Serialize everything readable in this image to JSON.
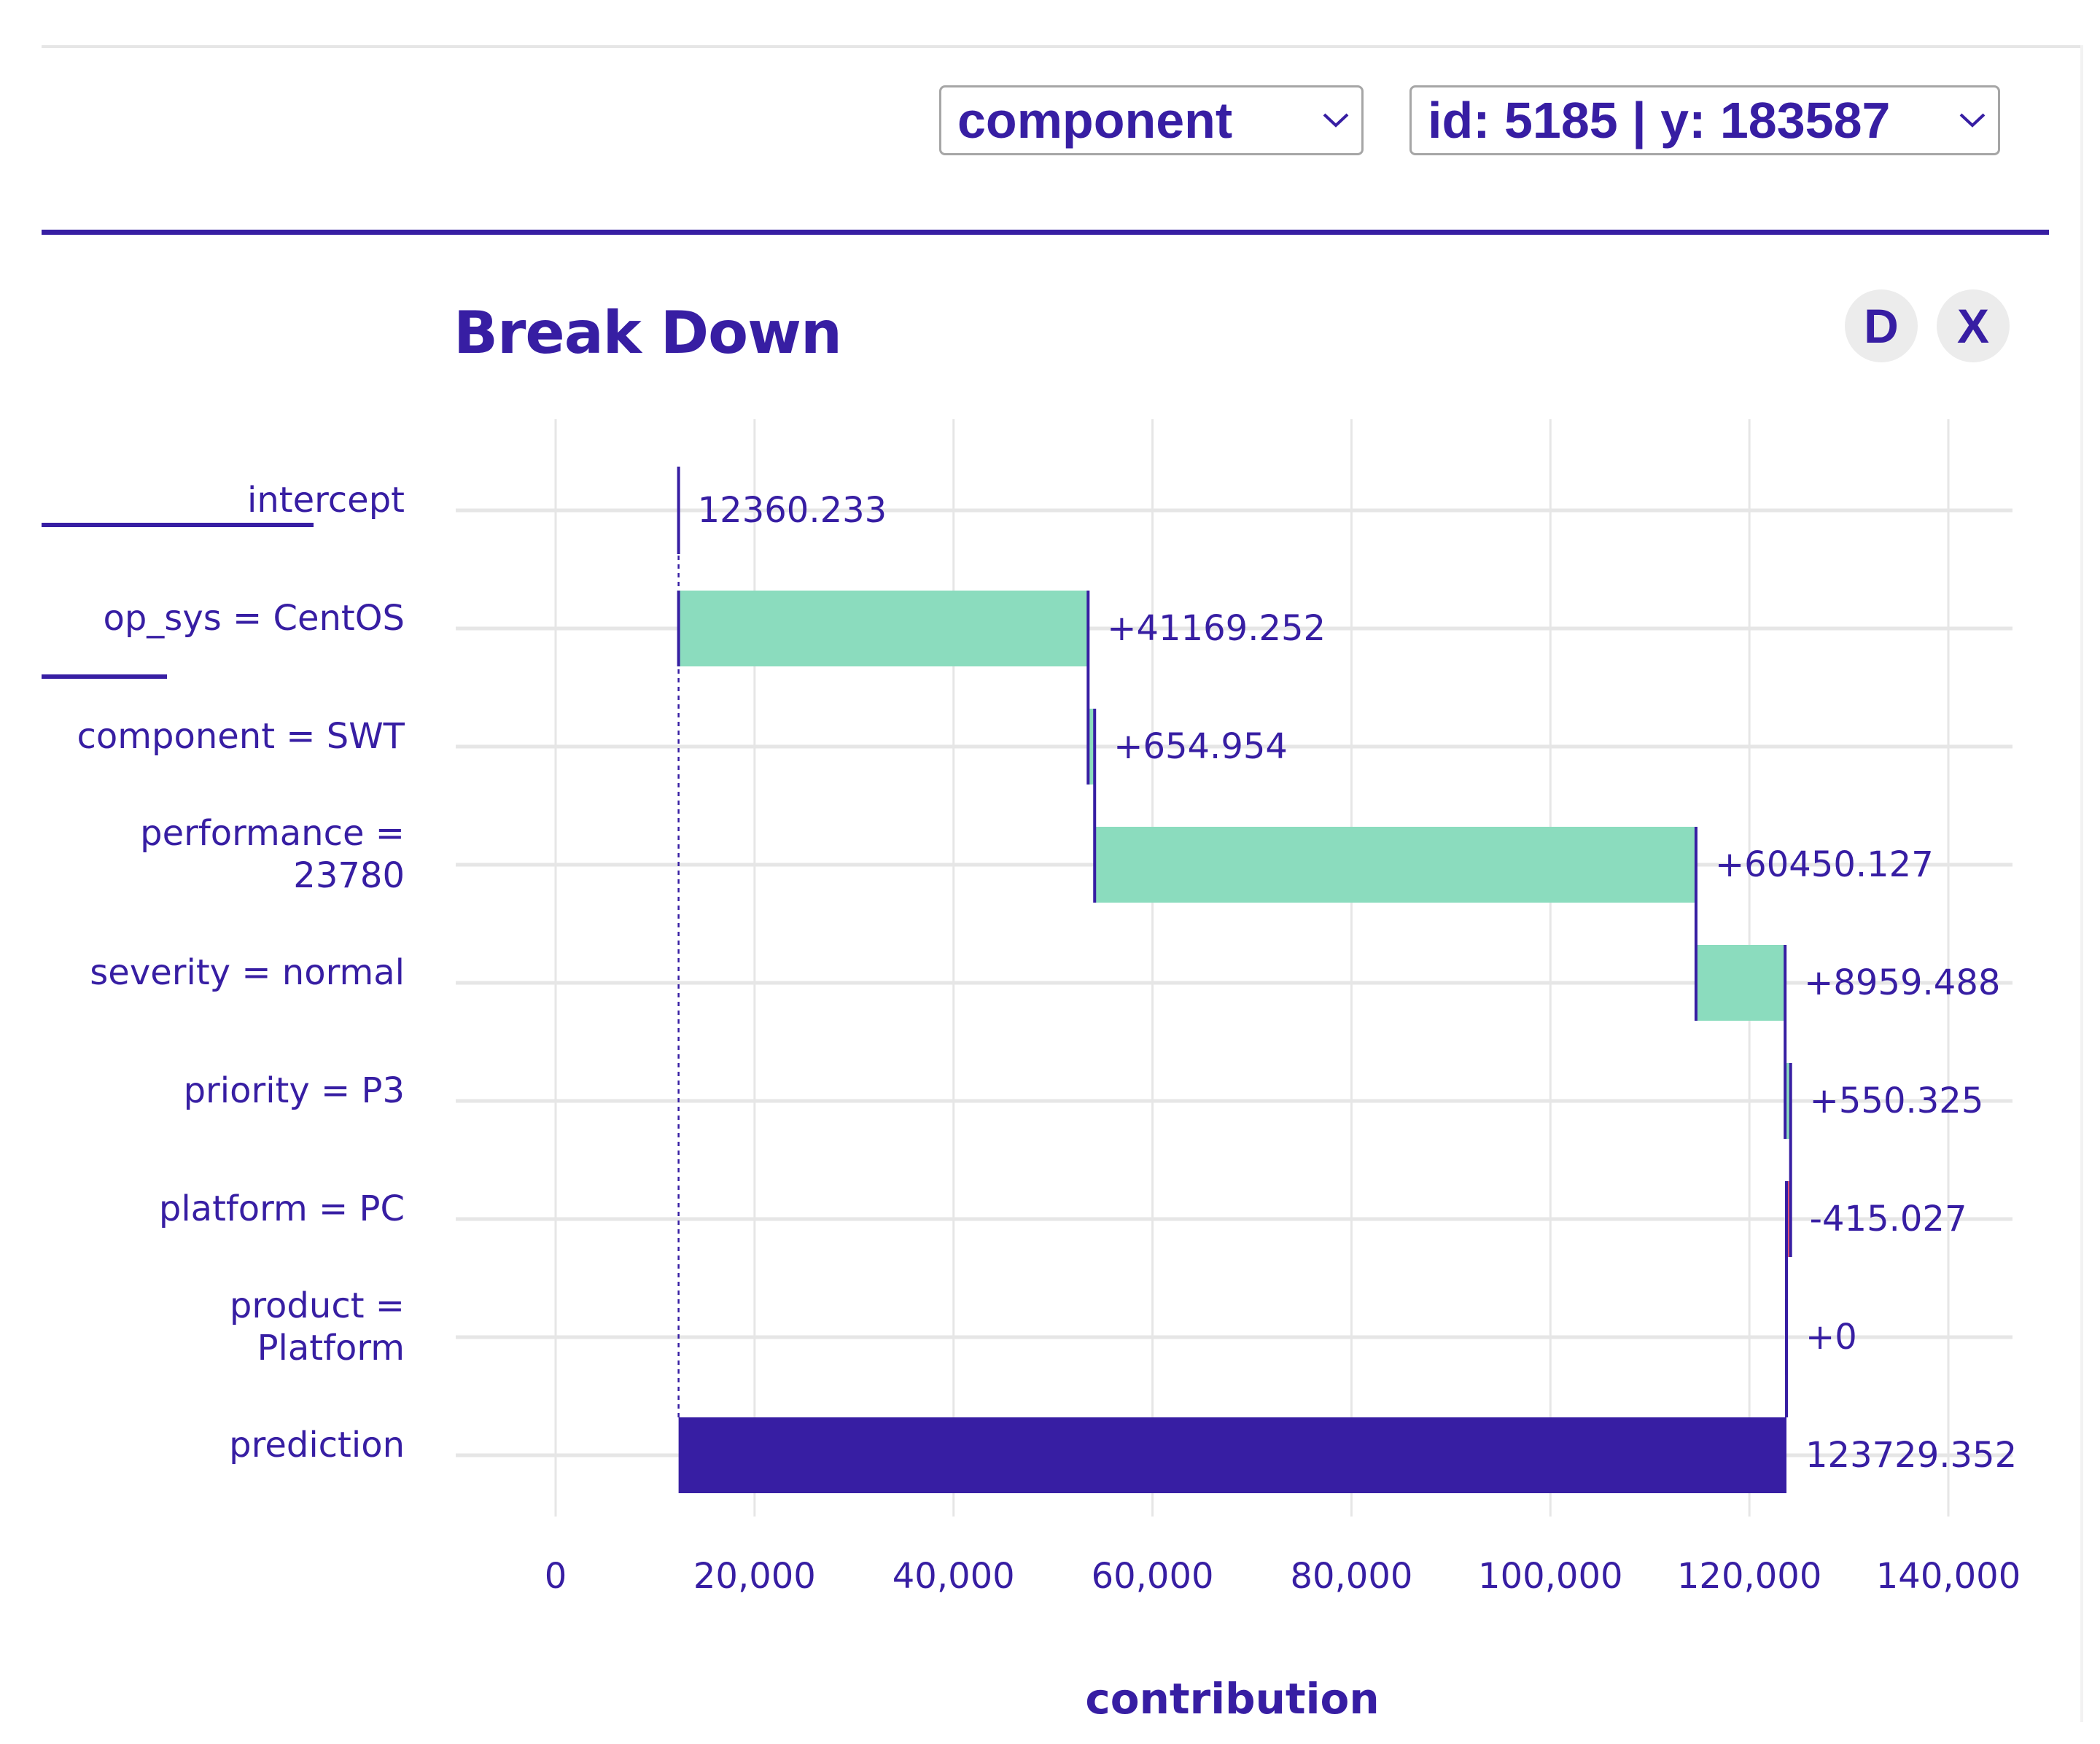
{
  "controls": {
    "variable_select": {
      "value": "component",
      "icon": "chevron-down-icon"
    },
    "observation_select": {
      "value": "id: 5185 | y: 183587",
      "icon": "chevron-down-icon"
    },
    "buttons": {
      "d_label": "D",
      "x_label": "X"
    }
  },
  "colors": {
    "primary": "#371ea3",
    "positive": "#8bdcbe",
    "negative": "#f05a71",
    "grid": "#e6e6e6"
  },
  "chart_data": {
    "type": "bar",
    "subtype": "waterfall",
    "title": "Break Down",
    "xlabel": "contribution",
    "ylabel": "",
    "xlim": [
      0,
      140000
    ],
    "xticks": [
      0,
      20000,
      40000,
      60000,
      80000,
      100000,
      120000,
      140000
    ],
    "xtick_labels": [
      "0",
      "20,000",
      "40,000",
      "60,000",
      "80,000",
      "100,000",
      "120,000",
      "140,000"
    ],
    "grid": true,
    "legend": "none",
    "rows": [
      {
        "label": [
          "intercept"
        ],
        "kind": "intercept",
        "value": 12360.233,
        "value_label": "12360.233"
      },
      {
        "label": [
          "op_sys = CentOS"
        ],
        "kind": "contribution",
        "value": 41169.252,
        "value_label": "+41169.252"
      },
      {
        "label": [
          "component = SWT"
        ],
        "kind": "contribution",
        "value": 654.954,
        "value_label": "+654.954"
      },
      {
        "label": [
          "performance =",
          "23780"
        ],
        "kind": "contribution",
        "value": 60450.127,
        "value_label": "+60450.127"
      },
      {
        "label": [
          "severity = normal"
        ],
        "kind": "contribution",
        "value": 8959.488,
        "value_label": "+8959.488"
      },
      {
        "label": [
          "priority = P3"
        ],
        "kind": "contribution",
        "value": 550.325,
        "value_label": "+550.325"
      },
      {
        "label": [
          "platform = PC"
        ],
        "kind": "contribution",
        "value": -415.027,
        "value_label": "-415.027"
      },
      {
        "label": [
          "product =",
          "Platform"
        ],
        "kind": "contribution",
        "value": 0,
        "value_label": "+0"
      },
      {
        "label": [
          "prediction"
        ],
        "kind": "prediction",
        "value": 123729.352,
        "value_label": "123729.352"
      }
    ]
  }
}
